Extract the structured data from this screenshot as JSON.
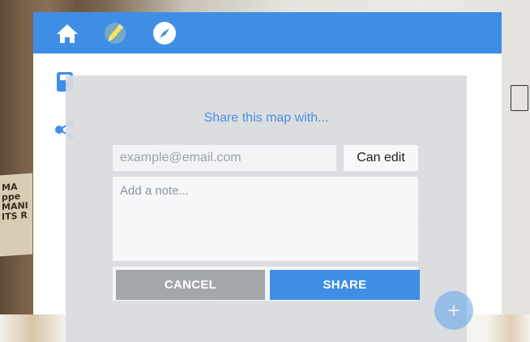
{
  "background": {
    "label_text": "MA\nppe\nMANI\nITS R"
  },
  "toolbar": {
    "home_icon": "home-icon",
    "edit_icon": "pencil-icon",
    "explore_icon": "compass-icon"
  },
  "side_tools": {
    "save_icon": "save-icon",
    "share_icon": "share-icon"
  },
  "dialog": {
    "title": "Share this map with...",
    "email_placeholder": "example@email.com",
    "permission": "Can edit",
    "note_placeholder": "Add a note...",
    "cancel_label": "CANCEL",
    "share_label": "SHARE"
  },
  "fab": {
    "label": "+"
  },
  "colors": {
    "brand": "#3f8ee6",
    "cancel": "#a3a6ab",
    "title": "#4a90e0"
  }
}
